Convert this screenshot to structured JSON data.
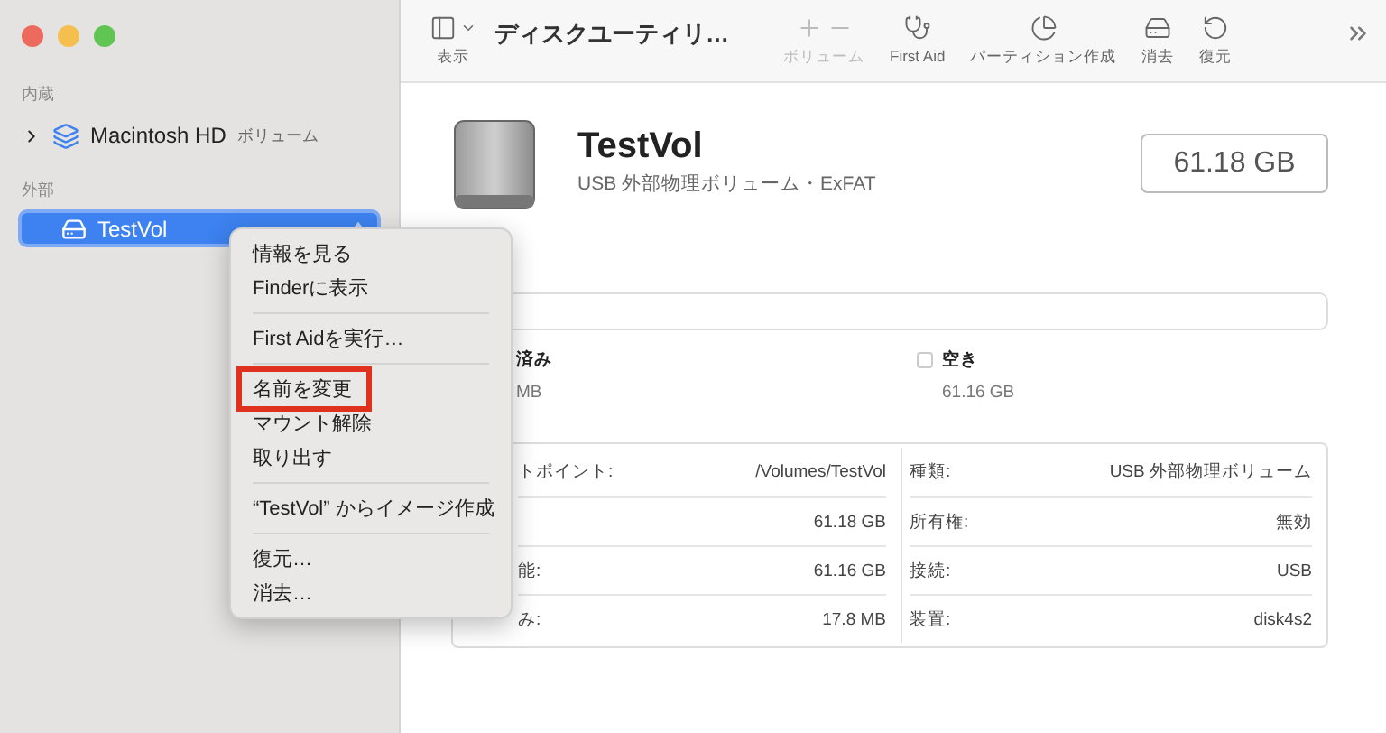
{
  "sidebar": {
    "sections": [
      {
        "heading": "内蔵",
        "items": [
          {
            "kind": "container",
            "name": "Macintosh HD",
            "detail": "ボリューム",
            "expanded": false,
            "selected": false
          }
        ]
      },
      {
        "heading": "外部",
        "items": [
          {
            "kind": "volume",
            "name": "TestVol",
            "selected": true
          }
        ]
      }
    ]
  },
  "toolbar": {
    "view_label": "表示",
    "title": "ディスクユーティリ…",
    "items": [
      {
        "kind": "volume",
        "label": "ボリューム",
        "disabled": true
      },
      {
        "kind": "first-aid",
        "label": "First Aid",
        "disabled": false
      },
      {
        "kind": "partition",
        "label": "パーティション作成",
        "disabled": false
      },
      {
        "kind": "erase",
        "label": "消去",
        "disabled": false
      },
      {
        "kind": "restore",
        "label": "復元",
        "disabled": false
      }
    ]
  },
  "volume": {
    "name": "TestVol",
    "subtitle": "USB 外部物理ボリューム・ExFAT",
    "capacity": "61.18 GB"
  },
  "usage": {
    "legend": [
      {
        "label": "済み",
        "value": "MB"
      },
      {
        "label": "空き",
        "value": "61.16 GB"
      }
    ]
  },
  "info": {
    "left": [
      {
        "label": "トポイント:",
        "value": "/Volumes/TestVol"
      },
      {
        "value": "61.18 GB"
      },
      {
        "label": "能:",
        "value": "61.16 GB"
      },
      {
        "label": "み:",
        "value": "17.8 MB"
      }
    ],
    "right": [
      {
        "label": "種類:",
        "value": "USB 外部物理ボリューム"
      },
      {
        "label": "所有権:",
        "value": "無効"
      },
      {
        "label": "接続:",
        "value": "USB"
      },
      {
        "label": "装置:",
        "value": "disk4s2"
      }
    ]
  },
  "context_menu": {
    "groups": [
      [
        {
          "label": "情報を見る",
          "highlighted": false
        },
        {
          "label": "Finderに表示",
          "highlighted": false
        }
      ],
      [
        {
          "label": "First Aidを実行…",
          "highlighted": false
        }
      ],
      [
        {
          "label": "名前を変更",
          "highlighted": true
        },
        {
          "label": "マウント解除",
          "highlighted": false
        },
        {
          "label": "取り出す",
          "highlighted": false
        }
      ],
      [
        {
          "label": "“TestVol” からイメージ作成",
          "highlighted": false
        }
      ],
      [
        {
          "label": "復元…",
          "highlighted": false
        },
        {
          "label": "消去…",
          "highlighted": false
        }
      ]
    ]
  }
}
